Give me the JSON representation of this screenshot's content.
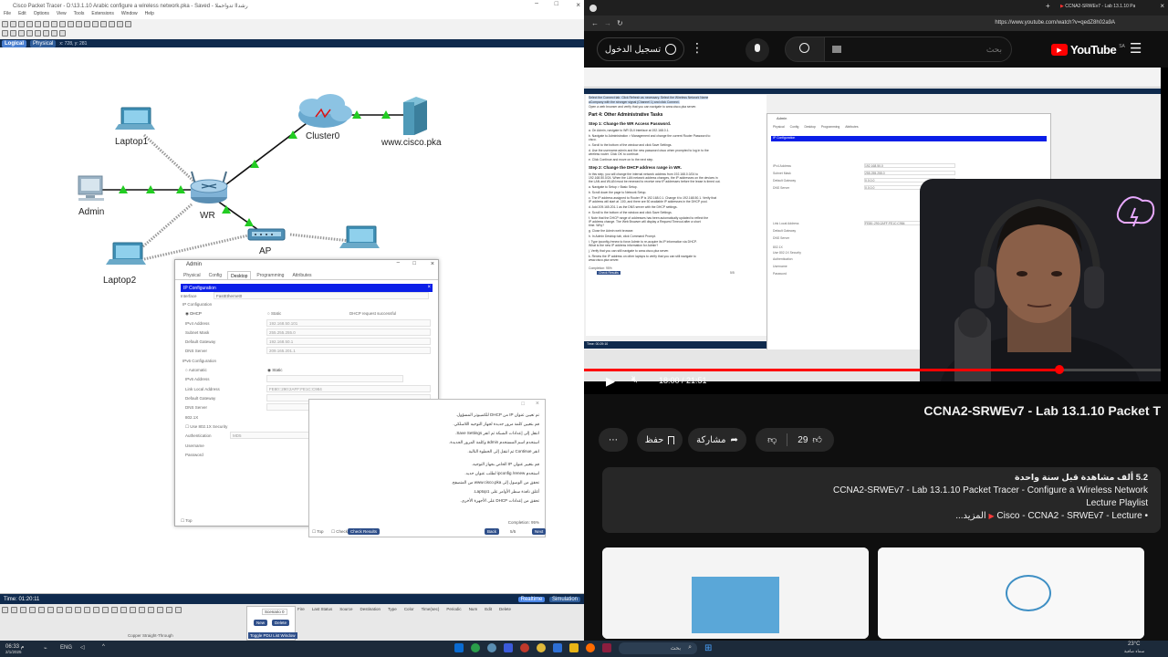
{
  "left_app": {
    "title": "Cisco Packet Tracer - D:\\13.1.10 Arabic configure a wireless network.pka - Saved - رشداا تدواحملا",
    "menu": [
      "File",
      "Edit",
      "Options",
      "View",
      "Tools",
      "Extensions",
      "Window",
      "Help"
    ],
    "tabs": {
      "logical": "Logical",
      "physical": "Physical",
      "coords": "x: 728, y: 281"
    },
    "devices": {
      "laptop1": "Laptop1",
      "admin": "Admin",
      "wr": "WR",
      "laptop2": "Laptop2",
      "cluster0": "Cluster0",
      "server": "www.cisco.pka",
      "ap": "AP"
    },
    "bottom": {
      "time": "Time: 01:20:11",
      "realtime": "Realtime",
      "simulation": "Simulation",
      "scenario": "Scenario 0",
      "new": "New",
      "delete": "Delete",
      "toggle_pdu": "Toggle PDU List Window",
      "pdu_columns": [
        "Fire",
        "Last Status",
        "Source",
        "Destination",
        "Type",
        "Color",
        "Time(sec)",
        "Periodic",
        "Num",
        "Edit",
        "Delete"
      ],
      "connection_hint": "Copper Straight-Through"
    },
    "admin_dialog": {
      "title": "Admin",
      "tabs": [
        "Physical",
        "Config",
        "Desktop",
        "Programming",
        "Attributes"
      ],
      "active_tab": "Desktop",
      "section_header": "IP Configuration",
      "interface_label": "Interface",
      "interface_value": "FastEthernet0",
      "ip_config_label": "IP Configuration",
      "dhcp": "DHCP",
      "static": "Static",
      "dhcp_status": "DHCP request successful",
      "ipv4_label": "IPv4 Address",
      "ipv4_value": "192.168.50.101",
      "subnet_label": "Subnet Mask",
      "subnet_value": "255.255.255.0",
      "gateway_label": "Default Gateway",
      "gateway_value": "192.168.50.1",
      "dns_label": "DNS Server",
      "dns_value": "209.165.201.1",
      "ipv6_section": "IPv6 Configuration",
      "automatic": "Automatic",
      "static6": "Static",
      "ipv6_label": "IPv6 Address",
      "link_local_label": "Link Local Address",
      "link_local_value": "FE80::290:2AFF:FE1C:C984",
      "gateway6_label": "Default Gateway",
      "dns6_label": "DNS Server",
      "dot1x": "802.1X",
      "use_dot1x": "Use 802.1X Security",
      "auth_label": "Authentication",
      "auth_value": "MD5",
      "username_label": "Username",
      "password_label": "Password",
      "top_checkbox": "Top"
    },
    "instruction_panel": {
      "lines": [
        "تم تعيين عنوان IP من DHCP للكمبيوتر المسؤول.",
        "قم بتعيين كلمة مرور جديدة لجهاز التوجيه اللاسلكي.",
        "انتقل إلى إعدادات الشبكة ثم انقر Save Settings.",
        "استخدم اسم المستخدم admin وكلمة المرور الجديدة.",
        "انقر Continue ثم انتقل إلى الخطوة التالية.",
        "قم بتغيير عنوان IP الخاص بجهاز التوجيه.",
        "استخدم ipconfig /renew لطلب عنوان جديد.",
        "تحقق من الوصول إلى www.cisco.pka من المتصفح.",
        "أغلق نافذة سطر الأوامر على Laptop1.",
        "تحقق من إعدادات DHCP على الأجهزة الأخرى."
      ],
      "top": "Top",
      "check": "Check",
      "check_results": "Check Results",
      "back": "Back",
      "page": "5/5",
      "next": "Next",
      "completion": "Completion: 95%"
    }
  },
  "browser": {
    "tab_title": "CCNA2-SRWEv7 - Lab 13.1.10 Pa",
    "url": "https://www.youtube.com/watch?v=qedZ8h02a9A",
    "signin": "تسجيل الدخول",
    "search_placeholder": "بحث",
    "logo": "YouTube",
    "region": "SA"
  },
  "video": {
    "time": "18:00 / 21:51",
    "inner_sections": [
      "Part 4: Other Administrative Tasks",
      "Step 1: Change the WR Access Password.",
      "Step 2: Change the DHCP address range in WR."
    ],
    "inner_dialog_title": "Admin",
    "inner_dialog_tabs": [
      "Physical",
      "Config",
      "Desktop",
      "Programming",
      "Attributes"
    ],
    "inner_ip_header": "IP Configuration",
    "inner_fields": [
      "IPv4 Address",
      "Subnet Mask",
      "Default Gateway",
      "DNS Server",
      "Link Local Address",
      "Default Gateway",
      "DNS Server",
      "802.1X",
      "Use 802.1X Security",
      "Authentication",
      "Username",
      "Password"
    ],
    "inner_values": [
      "192.168.50.0",
      "255.255.255.0",
      "0.0.0.0",
      "0.0.0.0",
      "FE80::290:2AFF:FE1C:C984"
    ],
    "inner_pt_time": "Time: 00:29:10",
    "inner_check_results": "Check Results",
    "inner_page": "5/5",
    "inner_completion": "Completion: 95%",
    "inner_lines": [
      "Select the Connect tab. Click Refresh as necessary. Select the Wireless Network Name",
      "aCompany with the stronger signal (Channel 1) and click Connect.",
      "Open a web browser and verify that you can navigate to www.cisco.pka server.",
      "a.  On Admin, navigate to WR GUI Interface at 192.168.0.1.",
      "b.  Navigate to Administration > Management and change the current Router Password to",
      "    cisco.",
      "c.  Scroll to the bottom of the window and click Save Settings.",
      "d.  Use the username admin and the new password cisco when prompted to log in to the",
      "    wireless router. Click OK to continue.",
      "e.  Click Continue and move on to the next step.",
      "In this step, you will change the internal network address from 192.168.0.0/24 to",
      "192.168.50.0/24. When the LAN network address changes, the IP addresses on the devices in",
      "the LAN and WLAN must be renewed to receive new IP addresses before the lease is timed out.",
      "a.  Navigate to Setup > Basic Setup.",
      "b.  Scroll down the page to Network Setup.",
      "c.  The IP address assigned to Router IP is 192.168.0.1. Change it to 192.168.50.1. Verify that",
      "    IP address will start at .100, and there are 50 available IP addresses in the DHCP pool.",
      "d.  Add 209.165.201.1 as the DNS server with the DHCP settings.",
      "e.  Scroll to the bottom of the window and click Save Settings.",
      "f.  Note that the DHCP range of addresses has been automatically updated to reflect the",
      "    IP address change. The Web Browser will display a Request Timeout after a short",
      "    time. Why?",
      "g.  Close the Admin web browser.",
      "h.  In Admin Desktop tab, click Command Prompt.",
      "i.  Type ipconfig /renew to force Admin to re-acquire its IP information via DHCP.",
      "    What is the new IP address information for Admin?",
      "j.  Verify that you can still navigate to www.cisco.pka server.",
      "k.  Renew the IP address on other laptops to verify that you can still navigate to",
      "    www.cisco.pka server."
    ]
  },
  "meta": {
    "title": "CCNA2-SRWEv7 - Lab 13.1.10 Packet T",
    "likes": "29",
    "share": "مشاركة",
    "save": "حفظ",
    "more": "⋯"
  },
  "description": {
    "views_line": "5.2 ألف مشاهدة  قبل سنة واحدة",
    "title_line": "CCNA2-SRWEv7 - Lab 13.1.10 Packet Tracer - Configure a Wireless Network",
    "playlist_line": "Lecture Playlist",
    "channel_line": "Cisco - CCNA2 - SRWEv7 - Lecture •",
    "more_label": "...المزيد"
  },
  "taskbar": {
    "time": "06:33 م",
    "date": "2/1/2025",
    "lang": "ENG",
    "weather": "23°C",
    "weather_sub": "سماء صافية",
    "search": "بحث"
  },
  "colors": {
    "pt_dark": "#0f2a4d",
    "dialog_header": "#0a1ee8",
    "yt_bg": "#0f0f0f",
    "yt_red": "#ff0000",
    "progress_red": "#ff0000",
    "link_green": "#22cc22"
  }
}
